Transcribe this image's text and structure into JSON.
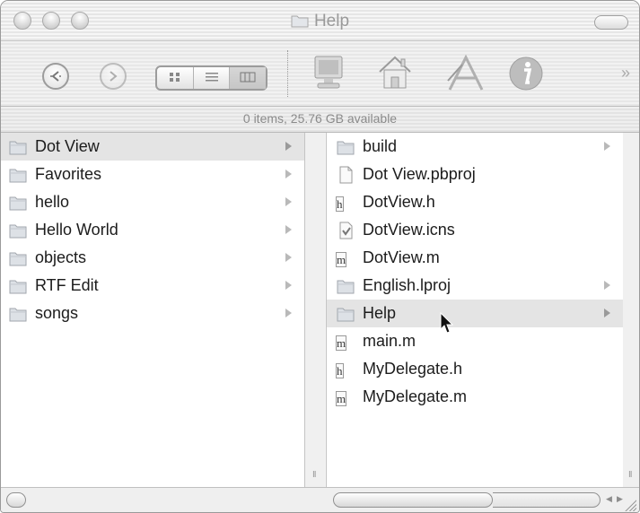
{
  "window": {
    "title": "Help",
    "status_text": "0 items, 25.76 GB available"
  },
  "toolbar": {
    "back": "back-button",
    "forward": "forward-button",
    "view_modes": [
      "icon-view",
      "list-view",
      "column-view"
    ],
    "selected_view": "column-view",
    "shortcuts": [
      "computer-icon",
      "home-icon",
      "applications-icon",
      "info-icon"
    ],
    "overflow": "»"
  },
  "columns": [
    {
      "items": [
        {
          "label": "Dot View",
          "icon": "folder-icon",
          "has_children": true,
          "selected": true
        },
        {
          "label": "Favorites",
          "icon": "folder-icon",
          "has_children": true
        },
        {
          "label": "hello",
          "icon": "folder-icon",
          "has_children": true
        },
        {
          "label": "Hello World",
          "icon": "folder-icon",
          "has_children": true
        },
        {
          "label": "objects",
          "icon": "folder-icon",
          "has_children": true
        },
        {
          "label": "RTF Edit",
          "icon": "folder-icon",
          "has_children": true
        },
        {
          "label": "songs",
          "icon": "folder-icon",
          "has_children": true
        }
      ]
    },
    {
      "items": [
        {
          "label": "build",
          "icon": "folder-icon",
          "has_children": true
        },
        {
          "label": "Dot View.pbproj",
          "icon": "document-icon",
          "has_children": false
        },
        {
          "label": "DotView.h",
          "icon": "h-file-icon",
          "badge": "h",
          "has_children": false
        },
        {
          "label": "DotView.icns",
          "icon": "icns-file-icon",
          "has_children": false
        },
        {
          "label": "DotView.m",
          "icon": "m-file-icon",
          "badge": "m",
          "has_children": false
        },
        {
          "label": "English.lproj",
          "icon": "folder-icon",
          "has_children": true
        },
        {
          "label": "Help",
          "icon": "folder-icon",
          "has_children": true,
          "selected": true
        },
        {
          "label": "main.m",
          "icon": "m-file-icon",
          "badge": "m",
          "has_children": false
        },
        {
          "label": "MyDelegate.h",
          "icon": "h-file-icon",
          "badge": "h",
          "has_children": false
        },
        {
          "label": "MyDelegate.m",
          "icon": "m-file-icon",
          "badge": "m",
          "has_children": false
        }
      ]
    }
  ],
  "colors": {
    "selection": "#e4e4e4",
    "folder": "#d4d8de"
  }
}
